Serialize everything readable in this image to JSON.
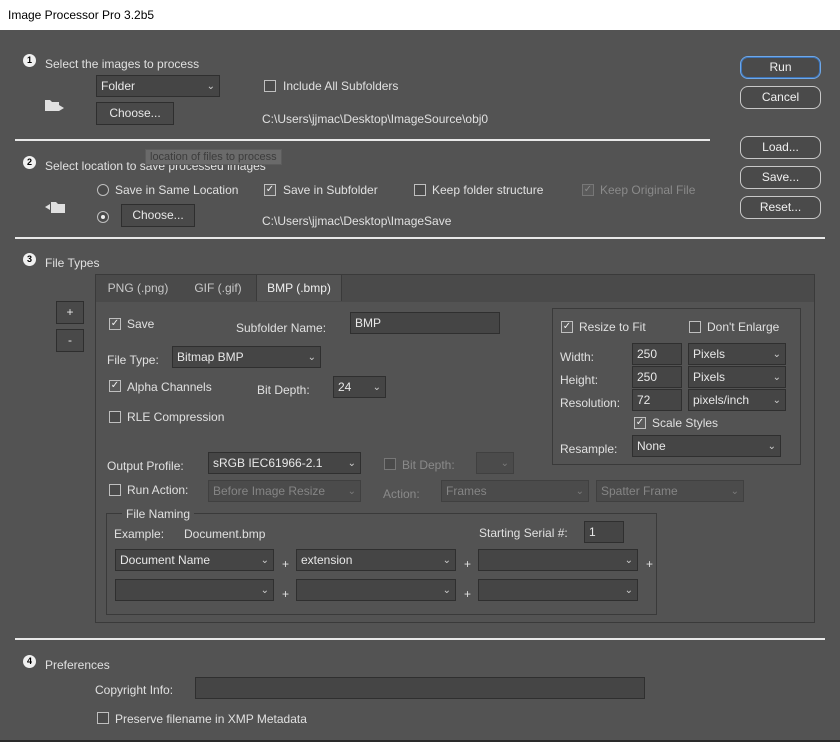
{
  "window": {
    "title": "Image Processor Pro 3.2b5"
  },
  "section1": {
    "number": "1",
    "title": "Select the images to process",
    "source_select": "Folder",
    "include_subfolders_label": "Include All Subfolders",
    "include_subfolders_checked": false,
    "choose_label": "Choose...",
    "path": "C:\\Users\\jjmac\\Desktop\\ImageSource\\obj0"
  },
  "section2": {
    "number": "2",
    "title": "Select location to save processed images",
    "tooltip": "location of files to process",
    "same_location_label": "Save in Same Location",
    "save_subfolder_label": "Save in Subfolder",
    "save_subfolder_checked": true,
    "keep_structure_label": "Keep folder structure",
    "keep_structure_checked": false,
    "keep_original_label": "Keep Original File",
    "keep_original_checked": true,
    "choose_label": "Choose...",
    "path": "C:\\Users\\jjmac\\Desktop\\ImageSave"
  },
  "actions": {
    "run": "Run",
    "cancel": "Cancel",
    "load": "Load...",
    "save": "Save...",
    "reset": "Reset..."
  },
  "section3": {
    "number": "3",
    "title": "File Types",
    "add_label": "+",
    "remove_label": "-",
    "tabs": [
      "PNG (.png)",
      "GIF (.gif)",
      "BMP (.bmp)"
    ],
    "active_tab": "BMP (.bmp)",
    "save_label": "Save",
    "save_checked": true,
    "subfolder_name_label": "Subfolder Name:",
    "subfolder_name_value": "BMP",
    "file_type_label": "File Type:",
    "file_type_value": "Bitmap BMP",
    "alpha_channels_label": "Alpha Channels",
    "alpha_channels_checked": true,
    "bit_depth_label": "Bit Depth:",
    "bit_depth_value": "24",
    "rle_label": "RLE Compression",
    "rle_checked": false,
    "resize": {
      "resize_to_fit_label": "Resize to Fit",
      "resize_to_fit_checked": true,
      "dont_enlarge_label": "Don't Enlarge",
      "dont_enlarge_checked": false,
      "width_label": "Width:",
      "width_value": "250",
      "width_unit": "Pixels",
      "height_label": "Height:",
      "height_value": "250",
      "height_unit": "Pixels",
      "resolution_label": "Resolution:",
      "resolution_value": "72",
      "resolution_unit": "pixels/inch",
      "scale_styles_label": "Scale Styles",
      "scale_styles_checked": true,
      "resample_label": "Resample:",
      "resample_value": "None"
    },
    "output_profile_label": "Output Profile:",
    "output_profile_value": "sRGB IEC61966-2.1",
    "profile_bit_depth_label": "Bit Depth:",
    "run_action_label": "Run Action:",
    "run_action_value": "Before Image Resize",
    "action_label": "Action:",
    "action_set_value": "Frames",
    "action_value": "Spatter Frame",
    "file_naming": {
      "title": "File Naming",
      "example_label": "Example:",
      "example_value": "Document.bmp",
      "serial_label": "Starting Serial #:",
      "serial_value": "1",
      "row1": [
        "Document Name",
        "extension",
        ""
      ],
      "row2": [
        "",
        "",
        ""
      ],
      "joiner": "+"
    }
  },
  "section4": {
    "number": "4",
    "title": "Preferences",
    "copyright_label": "Copyright Info:",
    "copyright_value": "",
    "preserve_label": "Preserve filename in XMP Metadata",
    "preserve_checked": false
  }
}
